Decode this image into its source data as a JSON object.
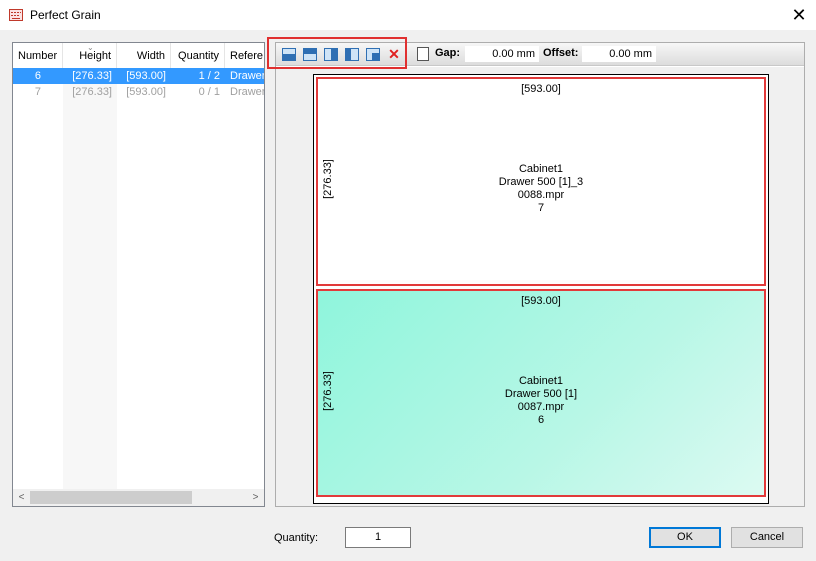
{
  "window": {
    "title": "Perfect Grain"
  },
  "list": {
    "columns": [
      "Number",
      "Height",
      "Width",
      "Quantity",
      "Refere"
    ],
    "rows": [
      {
        "number": "6",
        "height": "[276.33]",
        "width": "[593.00]",
        "quantity": "1 / 2",
        "reference": "Drawer"
      },
      {
        "number": "7",
        "height": "[276.33]",
        "width": "[593.00]",
        "quantity": "0 / 1",
        "reference": "Drawer"
      }
    ],
    "scroll_left": "<",
    "scroll_right": ">"
  },
  "toolbar": {
    "gap_label": "Gap:",
    "gap_value": "0.00 mm",
    "offset_label": "Offset:",
    "offset_value": "0.00 mm"
  },
  "parts": [
    {
      "width_dim": "[593.00]",
      "height_dim": "[276.33]",
      "line1": "Cabinet1",
      "line2": "Drawer 500 [1]_3",
      "line3": "0088.mpr",
      "line4": "7"
    },
    {
      "width_dim": "[593.00]",
      "height_dim": "[276.33]",
      "line1": "Cabinet1",
      "line2": "Drawer 500 [1]",
      "line3": "0087.mpr",
      "line4": "6"
    }
  ],
  "footer": {
    "quantity_label": "Quantity:",
    "quantity_value": "1",
    "ok_label": "OK",
    "cancel_label": "Cancel"
  },
  "colors": {
    "selection": "#3399ff",
    "highlight_border": "#e03030",
    "active_part": "#8ff5dc"
  }
}
